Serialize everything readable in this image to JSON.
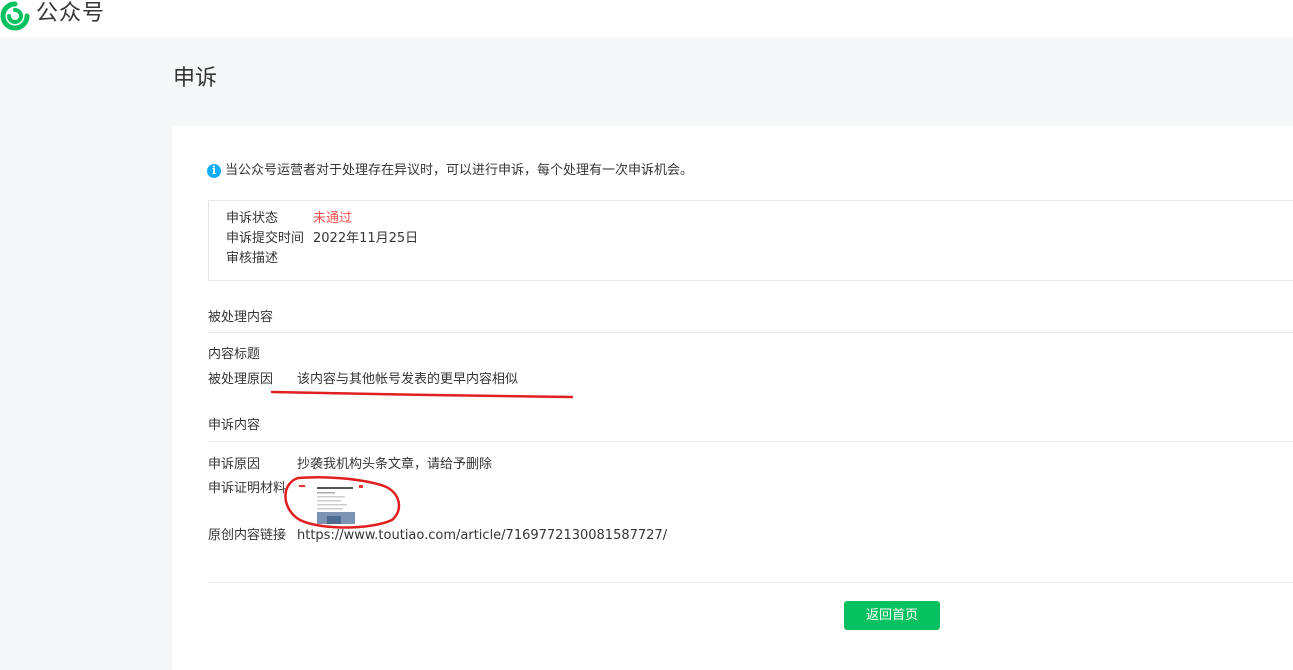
{
  "header": {
    "brand": "公众号"
  },
  "page": {
    "title": "申诉"
  },
  "notice": {
    "text": "当公众号运营者对于处理存在异议时，可以进行申诉，每个处理有一次申诉机会。"
  },
  "status": {
    "state_label": "申诉状态",
    "state_value": "未通过",
    "time_label": "申诉提交时间",
    "time_value": "2022年11月25日",
    "desc_label": "审核描述"
  },
  "processed": {
    "section_title": "被处理内容",
    "title_label": "内容标题",
    "reason_label": "被处理原因",
    "reason_value": "该内容与其他帐号发表的更早内容相似"
  },
  "appeal": {
    "section_title": "申诉内容",
    "reason_label": "申诉原因",
    "reason_value": "抄袭我机构头条文章，请给予删除",
    "evidence_label": "申诉证明材料",
    "link_label": "原创内容链接",
    "link_value": "https://www.toutiao.com/article/7169772130081587727/"
  },
  "actions": {
    "back_label": "返回首页"
  },
  "colors": {
    "accent": "#07c160",
    "error": "#fa5151",
    "info": "#10aeff",
    "annotation": "#e02020"
  }
}
